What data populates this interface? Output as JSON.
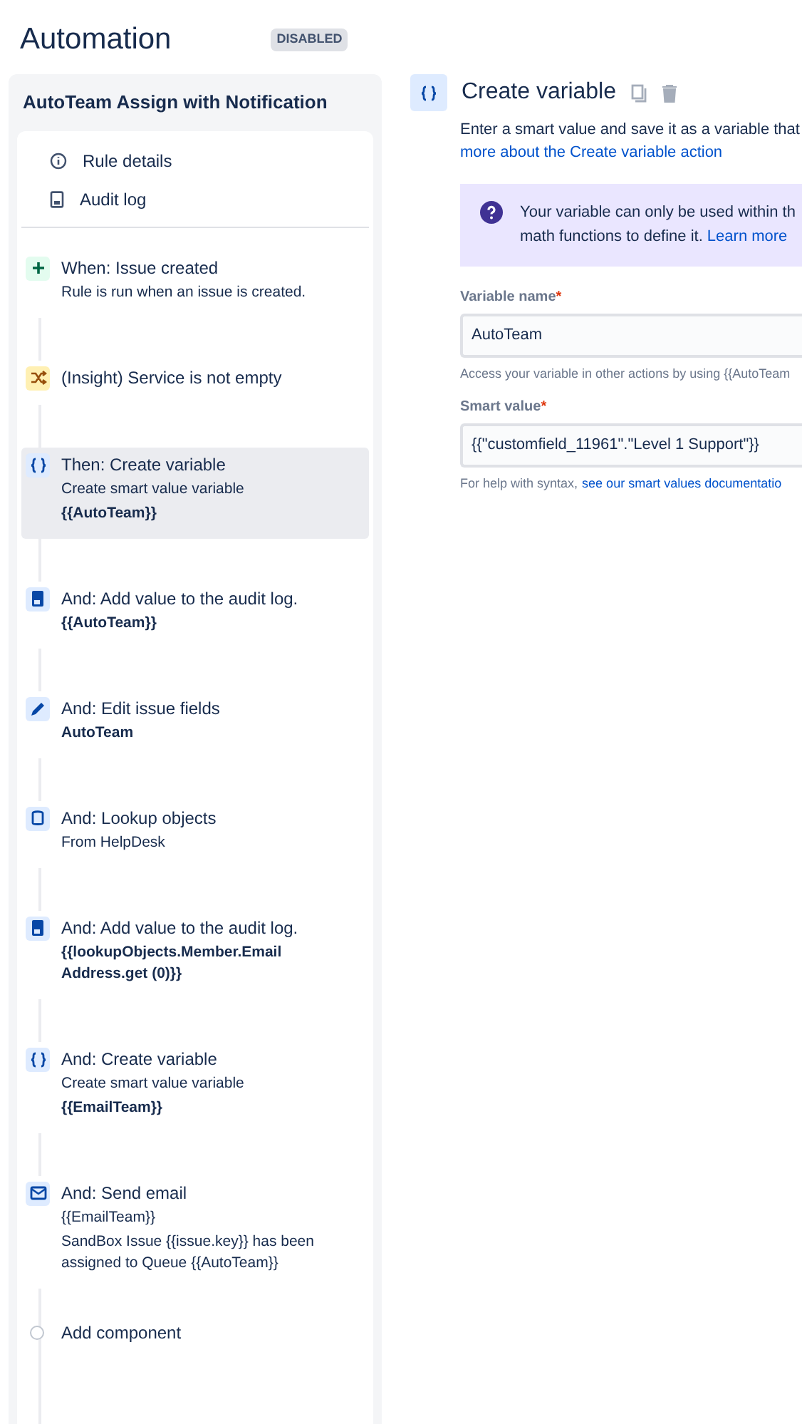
{
  "header": {
    "title": "Automation",
    "status": "DISABLED"
  },
  "rule": {
    "name": "AutoTeam Assign with Notification",
    "links": [
      {
        "kind": "info",
        "label": "Rule details"
      },
      {
        "kind": "log",
        "label": "Audit log"
      }
    ],
    "steps": [
      {
        "kind": "trigger",
        "title": "When: Issue created",
        "selected": false,
        "lines": [
          {
            "text": "Rule is run when an issue is created.",
            "bold": false
          }
        ]
      },
      {
        "kind": "condition",
        "title": "(Insight) Service is not empty",
        "selected": false
      },
      {
        "kind": "variable",
        "title": "Then: Create variable",
        "selected": true,
        "lines": [
          {
            "text": "Create smart value variable",
            "bold": false
          },
          {
            "text": "{{AutoTeam}}",
            "bold": true
          }
        ]
      },
      {
        "kind": "log",
        "title": "And: Add value to the audit log.",
        "selected": false,
        "lines": [
          {
            "text": "{{AutoTeam}}",
            "bold": true
          }
        ]
      },
      {
        "kind": "edit",
        "title": "And: Edit issue fields",
        "selected": false,
        "lines": [
          {
            "text": "AutoTeam",
            "bold": true
          }
        ]
      },
      {
        "kind": "lookup",
        "title": "And: Lookup objects",
        "selected": false,
        "lines": [
          {
            "text": "From HelpDesk",
            "bold": false
          }
        ]
      },
      {
        "kind": "log",
        "title": "And: Add value to the audit log.",
        "selected": false,
        "lines": [
          {
            "text": "{{lookupObjects.Member.Email Address.get (0)}}",
            "bold": true
          }
        ]
      },
      {
        "kind": "variable",
        "title": "And: Create variable",
        "selected": false,
        "lines": [
          {
            "text": "Create smart value variable",
            "bold": false
          },
          {
            "text": "{{EmailTeam}}",
            "bold": true
          }
        ]
      },
      {
        "kind": "email",
        "title": "And: Send email",
        "selected": false,
        "lines": [
          {
            "text": "{{EmailTeam}}",
            "bold": false
          },
          {
            "text": "SandBox Issue {{issue.key}} has been assigned to Queue {{AutoTeam}}",
            "bold": false
          }
        ]
      }
    ],
    "add_component": "Add component"
  },
  "detail": {
    "title": "Create variable",
    "intro": "Enter a smart value and save it as a variable that",
    "intro_link": "more about the Create variable action",
    "callout": {
      "text": "Your variable can only be used within th",
      "text2": "math functions to define it.",
      "link": "Learn more"
    },
    "fields": [
      {
        "label": "Variable name",
        "required_mark": "*",
        "value": "AutoTeam",
        "help": "Access your variable in other actions by using {{AutoTeam"
      },
      {
        "label": "Smart value",
        "required_mark": "*",
        "value": "{{\"customfield_11961\".\"Level 1 Support\"}}",
        "help": "For help with syntax,",
        "help_link": "see our smart values documentatio"
      }
    ]
  }
}
